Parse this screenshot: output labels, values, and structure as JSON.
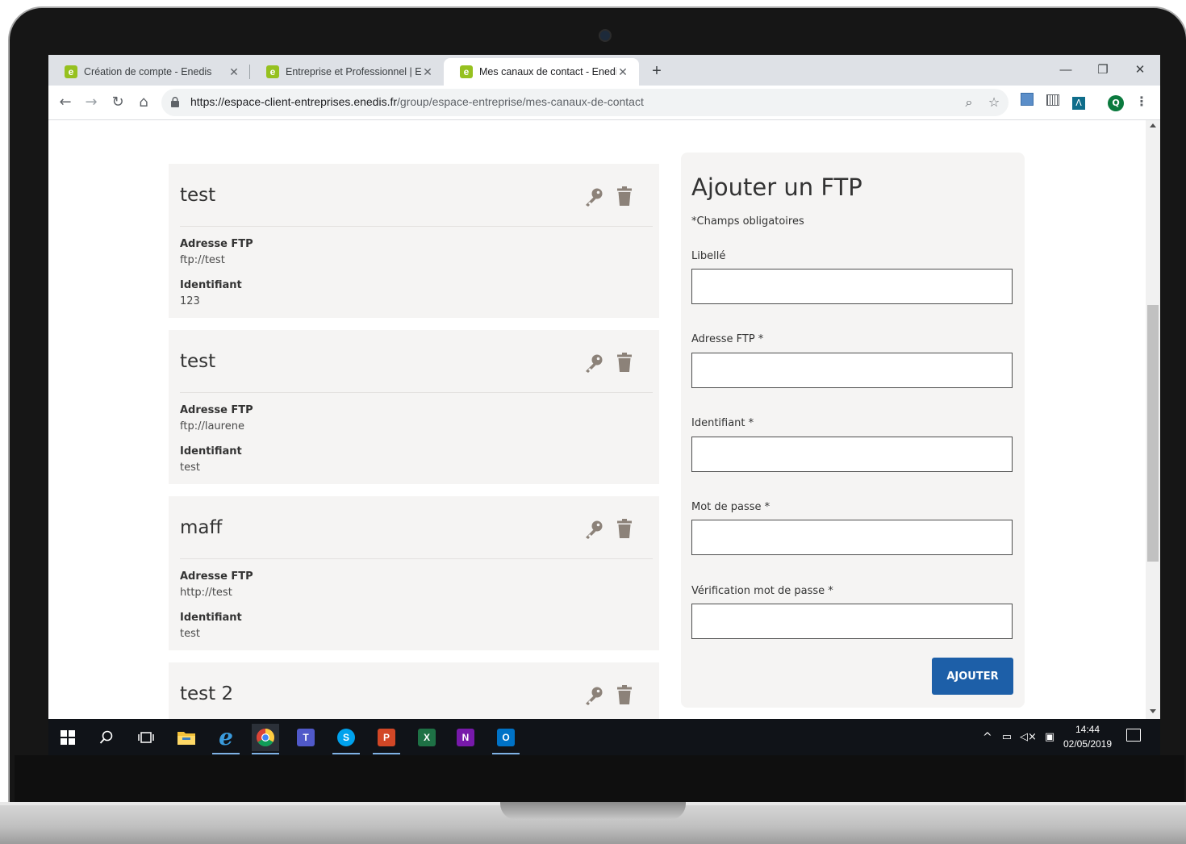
{
  "browser": {
    "tabs": [
      {
        "label": "Création de compte - Enedis",
        "favicon": "e"
      },
      {
        "label": "Entreprise et Professionnel | Enedis",
        "favicon": "e"
      },
      {
        "label": "Mes canaux de contact - Enedis",
        "favicon": "e",
        "active": true
      }
    ],
    "new_tab": "+",
    "url_host": "https://espace-client-entreprises.enedis.fr",
    "url_path": "/group/espace-entreprise/mes-canaux-de-contact",
    "profile_initial": "Q"
  },
  "ftp_list": [
    {
      "name": "test",
      "address_label": "Adresse FTP",
      "address": "ftp://test",
      "id_label": "Identifiant",
      "id": "123"
    },
    {
      "name": "test",
      "address_label": "Adresse FTP",
      "address": "ftp://laurene",
      "id_label": "Identifiant",
      "id": "test"
    },
    {
      "name": "maff",
      "address_label": "Adresse FTP",
      "address": "http://test",
      "id_label": "Identifiant",
      "id": "test"
    },
    {
      "name": "test 2"
    }
  ],
  "form": {
    "title": "Ajouter un FTP",
    "required_note": "*Champs obligatoires",
    "fields": [
      {
        "label": "Libellé",
        "value": ""
      },
      {
        "label": "Adresse FTP *",
        "value": ""
      },
      {
        "label": "Identifiant *",
        "value": ""
      },
      {
        "label": "Mot de passe *",
        "value": ""
      },
      {
        "label": "Vérification mot de passe *",
        "value": ""
      }
    ],
    "submit": "AJOUTER"
  },
  "taskbar": {
    "apps": [
      "windows-start",
      "search",
      "task-view",
      "file-explorer",
      "internet-explorer",
      "chrome",
      "teams",
      "skype",
      "powerpoint",
      "excel",
      "onenote",
      "outlook"
    ],
    "time": "14:44",
    "date": "02/05/2019"
  },
  "colors": {
    "card_bg": "#f5f4f3",
    "icon_brown": "#8c8279",
    "button_blue": "#1d5fa8",
    "enedis_green": "#96c11f"
  }
}
